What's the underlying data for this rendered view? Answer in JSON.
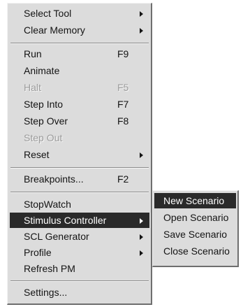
{
  "menu": {
    "items": [
      {
        "label": "Select Tool",
        "shortcut": "",
        "submenu": true
      },
      {
        "label": "Clear Memory",
        "shortcut": "",
        "submenu": true
      },
      {
        "label": "Run",
        "shortcut": "F9",
        "submenu": false
      },
      {
        "label": "Animate",
        "shortcut": "",
        "submenu": false
      },
      {
        "label": "Halt",
        "shortcut": "F5",
        "submenu": false,
        "disabled": true
      },
      {
        "label": "Step Into",
        "shortcut": "F7",
        "submenu": false
      },
      {
        "label": "Step Over",
        "shortcut": "F8",
        "submenu": false
      },
      {
        "label": "Step Out",
        "shortcut": "",
        "submenu": false,
        "disabled": true
      },
      {
        "label": "Reset",
        "shortcut": "",
        "submenu": true
      },
      {
        "label": "Breakpoints...",
        "shortcut": "F2",
        "submenu": false
      },
      {
        "label": "StopWatch",
        "shortcut": "",
        "submenu": false
      },
      {
        "label": "Stimulus Controller",
        "shortcut": "",
        "submenu": true,
        "selected": true
      },
      {
        "label": "SCL Generator",
        "shortcut": "",
        "submenu": true
      },
      {
        "label": "Profile",
        "shortcut": "",
        "submenu": true
      },
      {
        "label": "Refresh PM",
        "shortcut": "",
        "submenu": false
      },
      {
        "label": "Settings...",
        "shortcut": "",
        "submenu": false
      }
    ]
  },
  "submenu": {
    "items": [
      {
        "label": "New Scenario",
        "selected": true
      },
      {
        "label": "Open Scenario"
      },
      {
        "label": "Save Scenario"
      },
      {
        "label": "Close Scenario"
      }
    ]
  },
  "colors": {
    "menu_background": "#dcdcdc",
    "highlight": "#2a2a2a",
    "highlight_text": "#ffffff",
    "disabled_text": "#9c9c9c"
  }
}
